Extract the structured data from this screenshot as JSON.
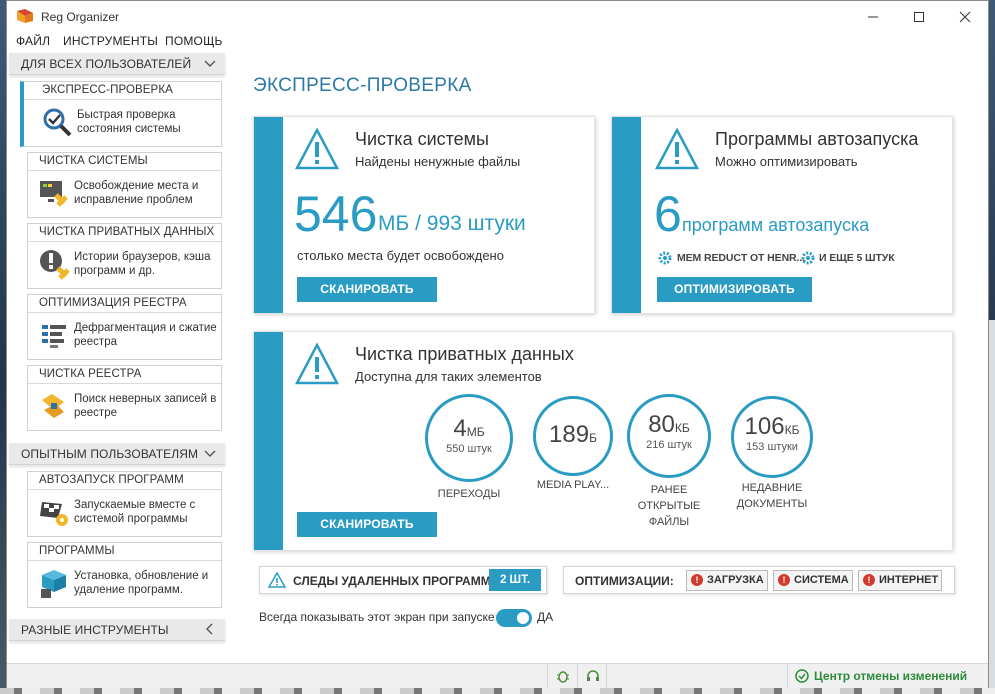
{
  "window": {
    "title": "Reg Organizer",
    "minimize_icon": "minimize-icon",
    "maximize_icon": "maximize-icon",
    "close_icon": "close-icon"
  },
  "menu": [
    "ФАЙЛ",
    "ИНСТРУМЕНТЫ",
    "ПОМОЩЬ"
  ],
  "sidebar": {
    "groups": [
      {
        "label": "ДЛЯ ВСЕХ ПОЛЬЗОВАТЕЛЕЙ",
        "icon": "chevron-down-icon"
      },
      {
        "label": "ОПЫТНЫМ ПОЛЬЗОВАТЕЛЯМ",
        "icon": "chevron-down-icon"
      },
      {
        "label": "РАЗНЫЕ ИНСТРУМЕНТЫ",
        "icon": "chevron-left-icon"
      }
    ],
    "items": [
      {
        "header": "ЭКСПРЕСС-ПРОВЕРКА",
        "text": "Быстрая проверка состояния системы",
        "icon": "magnifier-check-icon",
        "active": true
      },
      {
        "header": "ЧИСТКА СИСТЕМЫ",
        "text": "Освобождение места и исправление проблем",
        "icon": "system-clean-icon"
      },
      {
        "header": "ЧИСТКА ПРИВАТНЫХ ДАННЫХ",
        "text": "Истории браузеров, кэша программ и др.",
        "icon": "private-data-icon"
      },
      {
        "header": "ОПТИМИЗАЦИЯ РЕЕСТРА",
        "text": "Дефрагментация и сжатие реестра",
        "icon": "registry-optimize-icon"
      },
      {
        "header": "ЧИСТКА РЕЕСТРА",
        "text": "Поиск неверных записей в реестре",
        "icon": "registry-clean-icon"
      },
      {
        "header": "АВТОЗАПУСК ПРОГРАММ",
        "text": "Запускаемые вместе с системой программы",
        "icon": "startup-flag-icon"
      },
      {
        "header": "ПРОГРАММЫ",
        "text": "Установка, обновление и удаление программ.",
        "icon": "programs-box-icon"
      }
    ]
  },
  "main": {
    "title": "ЭКСПРЕСС-ПРОВЕРКА",
    "system_card": {
      "title": "Чистка системы",
      "subtitle": "Найдены ненужные файлы",
      "big_value": "546",
      "big_unit": "МБ / 993 штуки",
      "note": "столько места будет освобождено",
      "button": "СКАНИРОВАТЬ"
    },
    "startup_card": {
      "title": "Программы автозапуска",
      "subtitle": "Можно оптимизировать",
      "big_value": "6",
      "big_unit": "программ автозапуска",
      "items": [
        "MEM REDUCT OT HENR...",
        "И ЕЩЕ 5 ШТУК"
      ],
      "button": "ОПТИМИЗИРОВАТЬ"
    },
    "private_card": {
      "title": "Чистка приватных данных",
      "subtitle": "Доступна для таких элементов",
      "button": "СКАНИРОВАТЬ",
      "circles": [
        {
          "value": "4",
          "unit": "МБ",
          "count": "550 штук",
          "label": "ПЕРЕХОДЫ"
        },
        {
          "value": "189",
          "unit": "Б",
          "count": "",
          "label": "MEDIA PLAY..."
        },
        {
          "value": "80",
          "unit": "КБ",
          "count": "216 штук",
          "label": "РАНЕЕ\nОТКРЫТЫЕ\nФАЙЛЫ"
        },
        {
          "value": "106",
          "unit": "КБ",
          "count": "153 штуки",
          "label": "НЕДАВНИЕ\nДОКУМЕНТЫ"
        }
      ]
    },
    "traces": {
      "label": "СЛЕДЫ УДАЛЕННЫХ ПРОГРАММ",
      "badge": "2 ШТ."
    },
    "optim": {
      "label": "ОПТИМИЗАЦИИ:",
      "buttons": [
        "ЗАГРУЗКА",
        "СИСТЕМА",
        "ИНТЕРНЕТ"
      ]
    },
    "always_show": {
      "label": "Всегда показывать этот экран при запуске",
      "value": "ДА"
    }
  },
  "status": {
    "undo": "Центр отмены изменений"
  },
  "colors": {
    "accent": "#2a9cc3",
    "title_blue": "#2b79a6",
    "undo_green": "#2f8a3a",
    "warn_red": "#d23a2e"
  }
}
